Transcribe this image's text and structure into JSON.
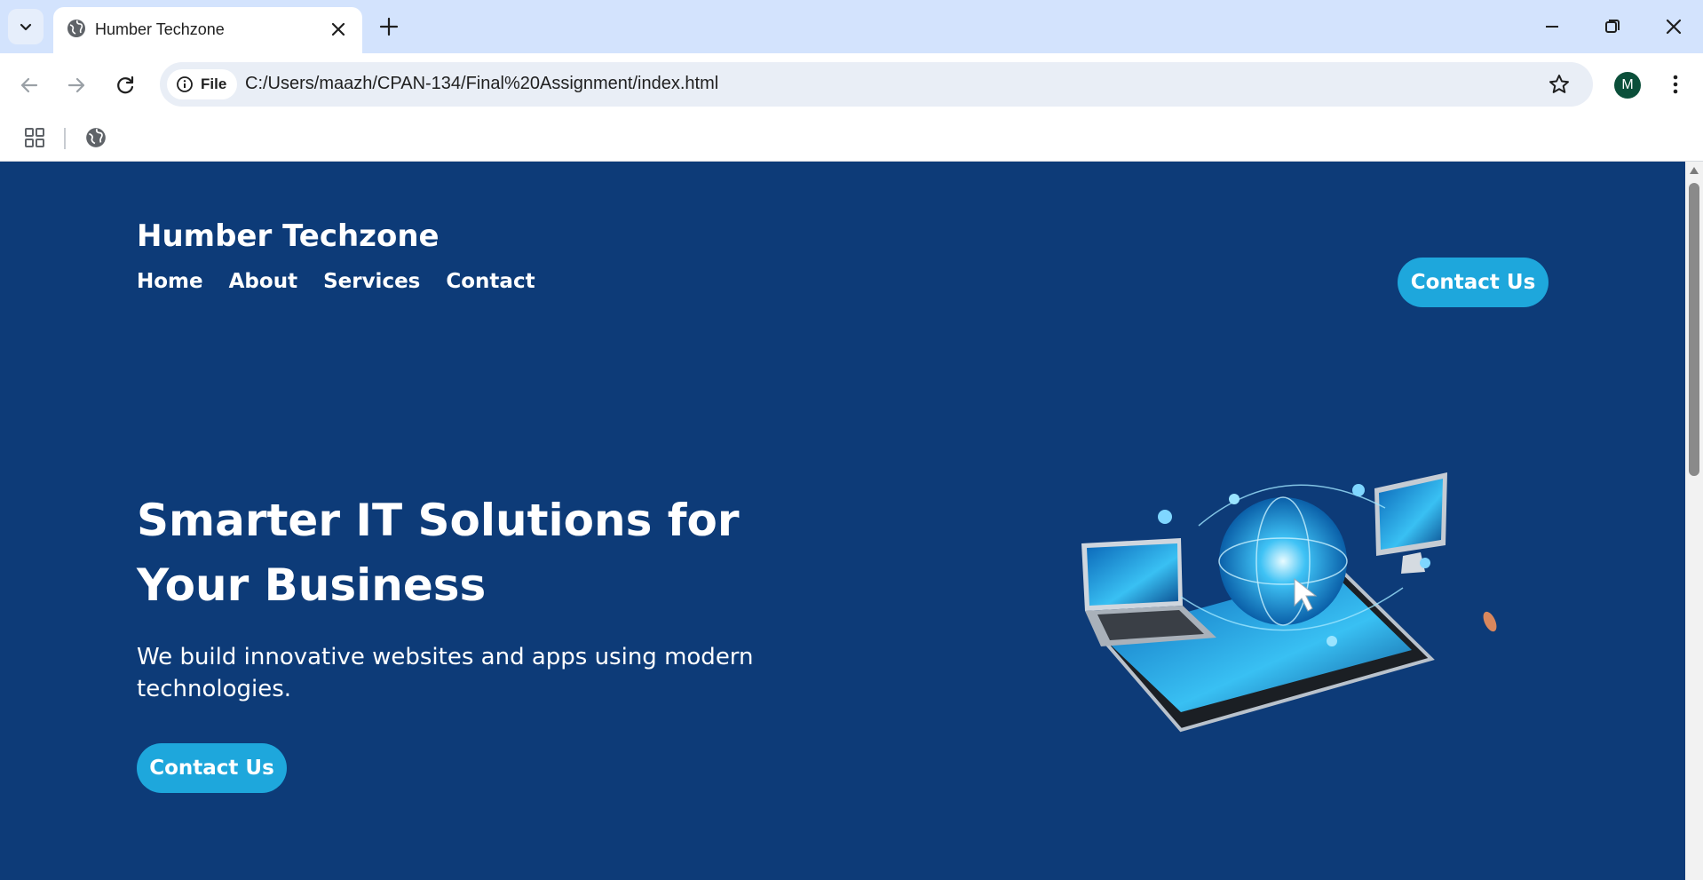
{
  "browser": {
    "tab": {
      "title": "Humber Techzone"
    },
    "address_bar": {
      "chip_label": "File",
      "url": "C:/Users/maazh/CPAN-134/Final%20Assignment/index.html"
    },
    "profile_initial": "M",
    "icons": {
      "tab_search": "chevron-down-icon",
      "favicon": "globe-icon",
      "tab_close": "close-icon",
      "new_tab": "plus-icon",
      "minimize": "minimize-icon",
      "restore": "restore-icon",
      "close_window": "close-icon",
      "back": "arrow-left-icon",
      "forward": "arrow-right-icon",
      "reload": "reload-icon",
      "info": "info-icon",
      "bookmark": "star-icon",
      "menu": "kebab-icon",
      "apps": "apps-grid-icon",
      "bookmark_globe": "globe-icon"
    }
  },
  "site": {
    "brand": "Humber Techzone",
    "nav": [
      "Home",
      "About",
      "Services",
      "Contact"
    ],
    "header_cta": "Contact Us",
    "hero": {
      "title": "Smarter IT Solutions for Your Business",
      "subtitle": "We build innovative websites and apps using modern technologies.",
      "cta": "Contact Us"
    }
  },
  "colors": {
    "page_background": "#0d3b78",
    "accent": "#1ea7dc",
    "tabstrip": "#d3e3fd",
    "omnibox": "#e9eef6"
  }
}
